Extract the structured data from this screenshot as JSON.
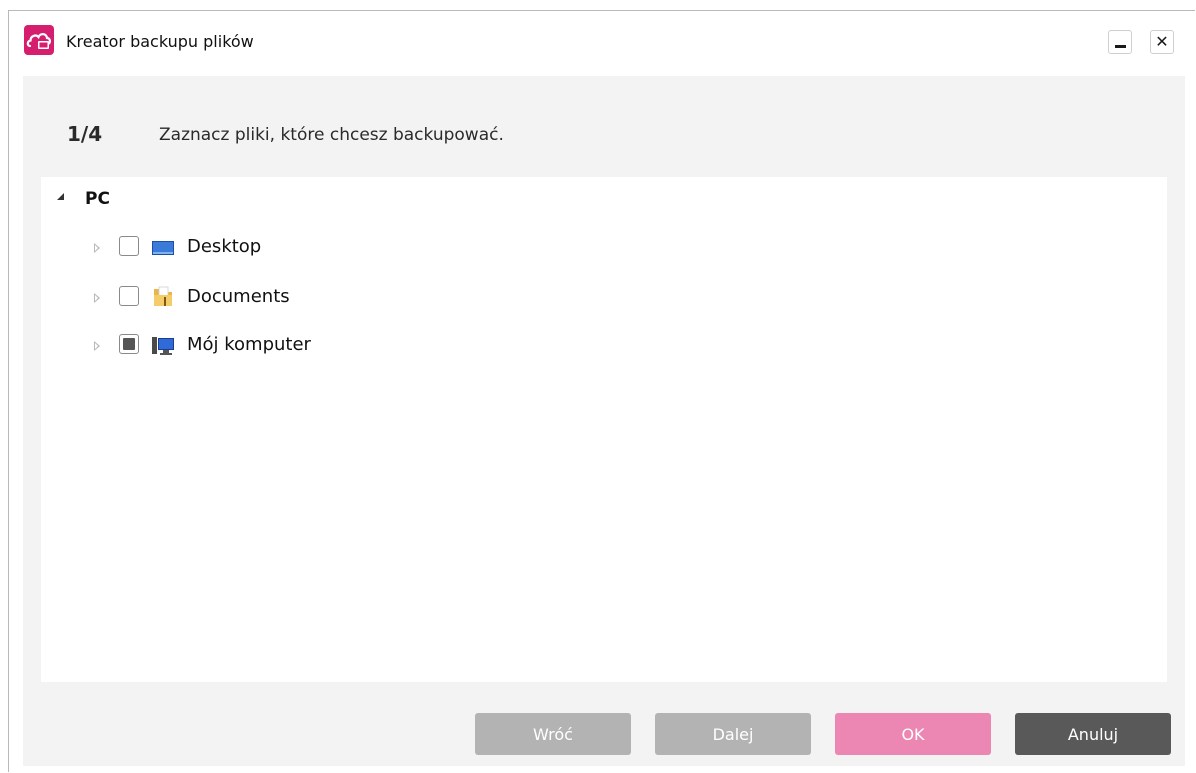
{
  "window": {
    "title": "Kreator backupu plików",
    "app_icon": "cloud-icon",
    "accent_color": "#d51f6e",
    "minimize_icon": "minimize-icon",
    "close_icon": "close-icon"
  },
  "step": {
    "number": "1/4",
    "instruction": "Zaznacz pliki, które chcesz backupować."
  },
  "tree": {
    "root": {
      "label": "PC",
      "expanded": true
    },
    "items": [
      {
        "label": "Desktop",
        "icon": "desktop-icon",
        "checked": "unchecked"
      },
      {
        "label": "Documents",
        "icon": "folder-icon",
        "checked": "unchecked"
      },
      {
        "label": "Mój komputer",
        "icon": "computer-icon",
        "checked": "partial"
      }
    ]
  },
  "buttons": {
    "back": "Wróć",
    "next": "Dalej",
    "ok": "OK",
    "cancel": "Anuluj"
  }
}
